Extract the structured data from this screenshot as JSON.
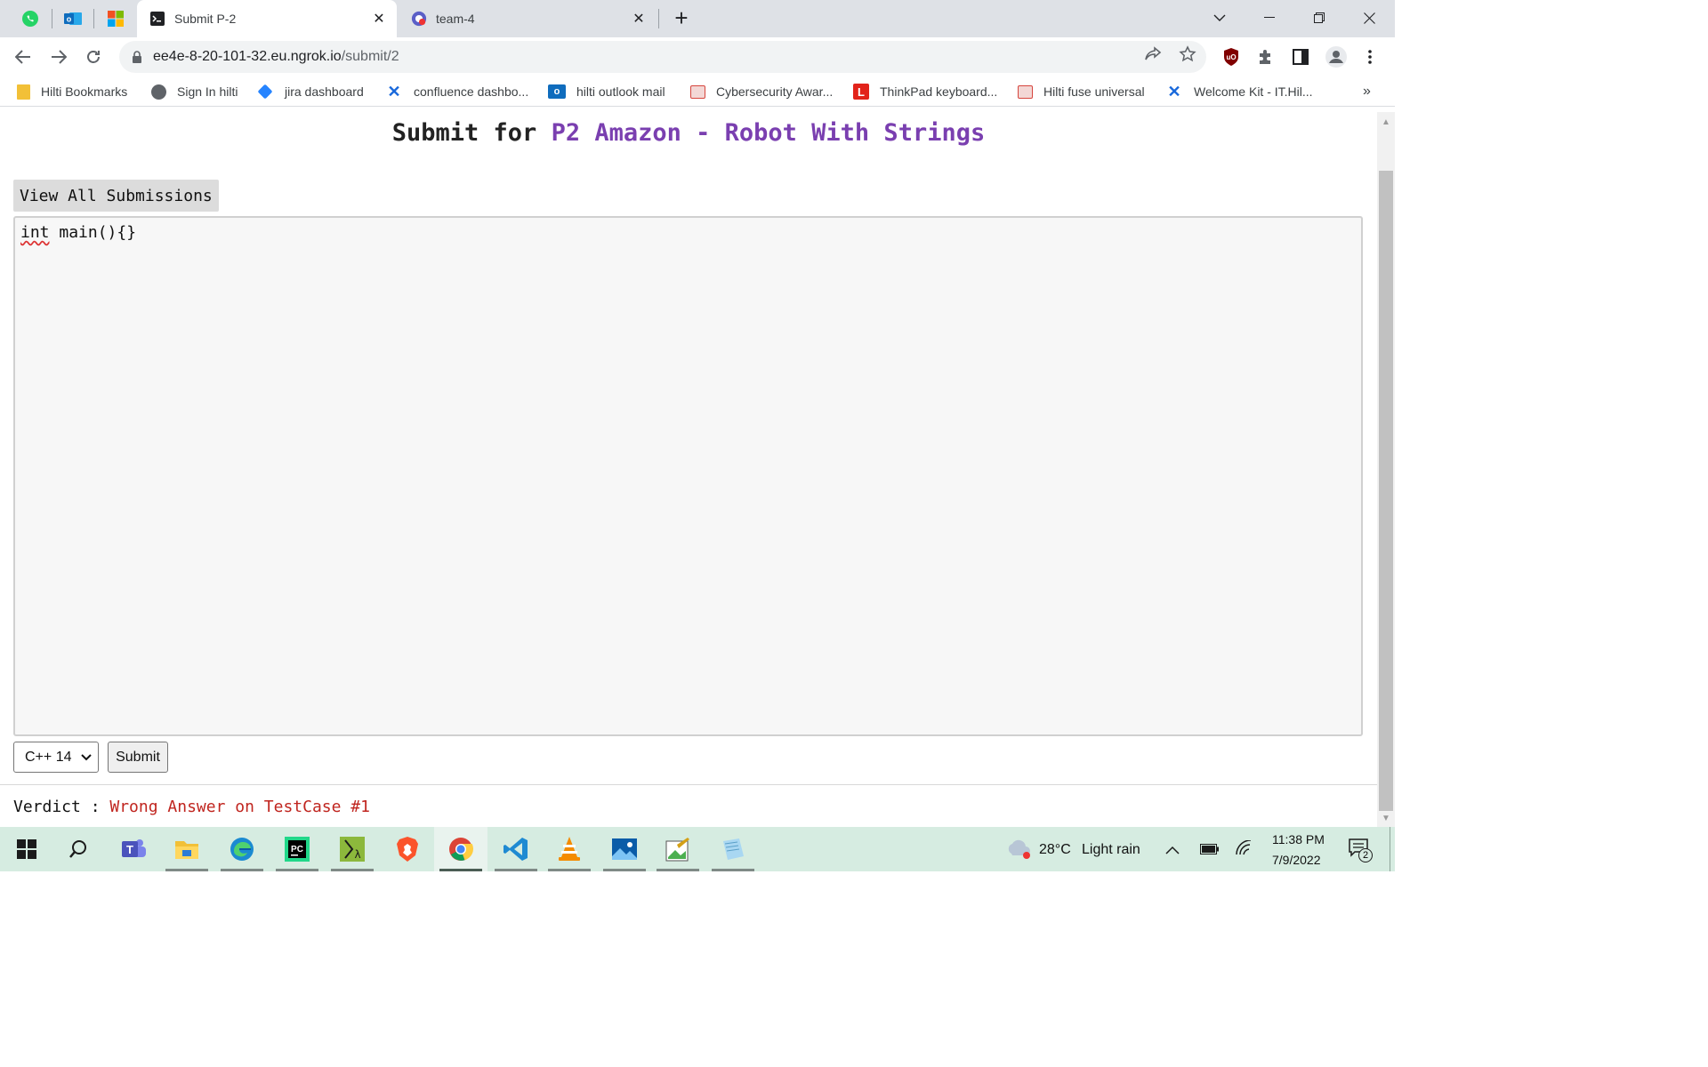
{
  "browser": {
    "tabs": [
      {
        "title": "Submit P-2",
        "active": true,
        "favicon": "terminal-icon"
      },
      {
        "title": "team-4",
        "active": false,
        "favicon": "app-icon"
      }
    ],
    "pinned_tabs": [
      "whatsapp-icon",
      "outlook-icon",
      "microsoft-icon"
    ],
    "url_host": "ee4e-8-20-101-32.eu.ngrok.io",
    "url_path": "/submit/2",
    "bookmarks": [
      {
        "label": "Hilti Bookmarks",
        "icon": "folder-icon",
        "color": "#f2c037"
      },
      {
        "label": "Sign In hilti",
        "icon": "globe-icon",
        "color": "#5f6368"
      },
      {
        "label": "jira dashboard",
        "icon": "jira-icon",
        "color": "#2684ff"
      },
      {
        "label": "confluence dashbo...",
        "icon": "confluence-icon",
        "color": "#1868db"
      },
      {
        "label": "hilti outlook mail",
        "icon": "outlook-icon",
        "color": "#0f6cbd"
      },
      {
        "label": "Cybersecurity Awar...",
        "icon": "hilti-icon",
        "color": "#d6453d"
      },
      {
        "label": "ThinkPad keyboard...",
        "icon": "lenovo-icon",
        "color": "#e2231a"
      },
      {
        "label": "Hilti fuse universal",
        "icon": "hilti-icon",
        "color": "#d6453d"
      },
      {
        "label": "Welcome Kit - IT.Hil...",
        "icon": "confluence-icon",
        "color": "#1868db"
      }
    ],
    "bookmarks_overflow": "»"
  },
  "page": {
    "title_prefix": "Submit for ",
    "title_problem": "P2 Amazon - Robot With Strings",
    "view_all_label": "View All Submissions",
    "code_keyword": "int",
    "code_rest": " main(){}",
    "language_selected": "C++ 14",
    "submit_label": "Submit",
    "verdict_label": "Verdict : ",
    "verdict_value": "Wrong Answer on TestCase #1",
    "colors": {
      "problem_link": "#7a3fb0",
      "verdict_bad": "#c0251f"
    }
  },
  "taskbar": {
    "apps": [
      "windows-start-icon",
      "search-icon",
      "teams-icon",
      "file-explorer-icon",
      "edge-icon",
      "pycharm-icon",
      "lambda-app-icon",
      "brave-icon",
      "chrome-icon",
      "vscode-icon",
      "vlc-icon",
      "photos-icon",
      "paint-icon",
      "notepad-icon"
    ],
    "weather_temp": "28°C",
    "weather_desc": "Light rain",
    "time": "11:38 PM",
    "date": "7/9/2022",
    "notification_count": "2"
  }
}
